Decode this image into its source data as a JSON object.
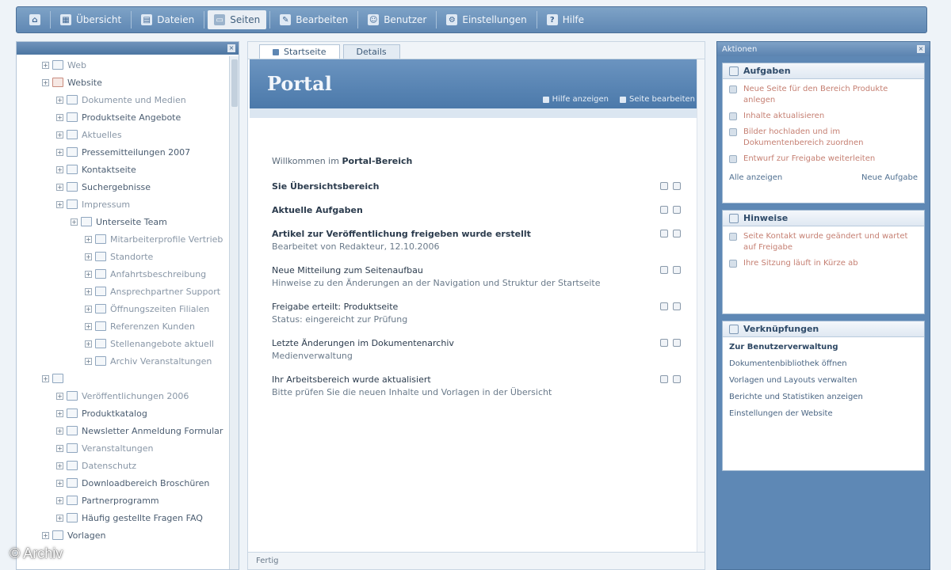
{
  "toolbar": {
    "items": [
      {
        "icon": "home-icon",
        "label": ""
      },
      {
        "icon": "dashboard-icon",
        "label": "Übersicht"
      },
      {
        "icon": "folder-icon",
        "label": "Dateien"
      },
      {
        "icon": "page-icon",
        "label": "Seiten"
      },
      {
        "icon": "edit-icon",
        "label": "Bearbeiten"
      },
      {
        "icon": "user-icon",
        "label": "Benutzer"
      },
      {
        "icon": "settings-icon",
        "label": "Einstellungen"
      },
      {
        "icon": "help-icon",
        "label": "Hilfe"
      }
    ],
    "active_index": 3
  },
  "left": {
    "tree": [
      {
        "depth": 1,
        "label": "Web",
        "style": "faint"
      },
      {
        "depth": 1,
        "label": "Website",
        "style": "normal",
        "icon": "red"
      },
      {
        "depth": 2,
        "label": "Dokumente und Medien",
        "style": "faint"
      },
      {
        "depth": 2,
        "label": "Produktseite Angebote",
        "style": "normal"
      },
      {
        "depth": 2,
        "label": "Aktuelles",
        "style": "faint"
      },
      {
        "depth": 2,
        "label": "Pressemitteilungen 2007",
        "style": "normal"
      },
      {
        "depth": 2,
        "label": "Kontaktseite",
        "style": "normal"
      },
      {
        "depth": 2,
        "label": "Suchergebnisse",
        "style": "normal"
      },
      {
        "depth": 2,
        "label": "Impressum",
        "style": "faint"
      },
      {
        "depth": 3,
        "label": "Unterseite Team",
        "style": "normal"
      },
      {
        "depth": 4,
        "label": "Mitarbeiterprofile Vertrieb",
        "style": "faint"
      },
      {
        "depth": 4,
        "label": "Standorte",
        "style": "faint"
      },
      {
        "depth": 4,
        "label": "Anfahrtsbeschreibung",
        "style": "faint"
      },
      {
        "depth": 4,
        "label": "Ansprechpartner Support",
        "style": "faint"
      },
      {
        "depth": 4,
        "label": "Öffnungszeiten Filialen",
        "style": "faint"
      },
      {
        "depth": 4,
        "label": "Referenzen Kunden",
        "style": "faint"
      },
      {
        "depth": 4,
        "label": "Stellenangebote aktuell",
        "style": "faint"
      },
      {
        "depth": 4,
        "label": "Archiv Veranstaltungen",
        "style": "faint"
      },
      {
        "depth": 1,
        "label": "",
        "style": "faint"
      },
      {
        "depth": 2,
        "label": "Veröffentlichungen 2006",
        "style": "faint"
      },
      {
        "depth": 2,
        "label": "Produktkatalog",
        "style": "normal"
      },
      {
        "depth": 2,
        "label": "Newsletter Anmeldung Formular",
        "style": "normal"
      },
      {
        "depth": 2,
        "label": "Veranstaltungen",
        "style": "faint"
      },
      {
        "depth": 2,
        "label": "Datenschutz",
        "style": "faint"
      },
      {
        "depth": 2,
        "label": "Downloadbereich Broschüren",
        "style": "normal"
      },
      {
        "depth": 2,
        "label": "Partnerprogramm",
        "style": "normal"
      },
      {
        "depth": 2,
        "label": "Häufig gestellte Fragen FAQ",
        "style": "normal"
      },
      {
        "depth": 1,
        "label": "Vorlagen",
        "style": "normal"
      }
    ]
  },
  "center": {
    "tabs": [
      "Startseite",
      "Details"
    ],
    "title": "Portal",
    "banner_links": [
      "Hilfe anzeigen",
      "Seite bearbeiten"
    ],
    "intro_prefix": "Willkommen im",
    "intro_bold": "Portal-Bereich",
    "entries": [
      {
        "heading": "Sie Übersichtsbereich",
        "sub": "",
        "bold": true
      },
      {
        "heading": "Aktuelle Aufgaben",
        "sub": "",
        "bold": true
      },
      {
        "heading": "Artikel zur Veröffentlichung freigeben wurde erstellt",
        "sub": "Bearbeitet von Redakteur, 12.10.2006",
        "bold": true
      },
      {
        "heading": "Neue Mitteilung zum Seitenaufbau",
        "sub": "Hinweise zu den Änderungen an der Navigation und Struktur der Startseite",
        "bold": false
      },
      {
        "heading": "Freigabe erteilt: Produktseite",
        "sub": "Status: eingereicht zur Prüfung",
        "bold": false
      },
      {
        "heading": "Letzte Änderungen im Dokumentenarchiv",
        "sub": "Medienverwaltung",
        "bold": false
      },
      {
        "heading": "Ihr Arbeitsbereich wurde aktualisiert",
        "sub": "Bitte prüfen Sie die neuen Inhalte und Vorlagen in der Übersicht",
        "bold": false
      }
    ],
    "status": "Fertig"
  },
  "right": {
    "header": "Aktionen",
    "panel1": {
      "title": "Aufgaben",
      "items": [
        {
          "text": "Neue Seite für den Bereich Produkte anlegen",
          "tone": "red"
        },
        {
          "text": "Inhalte aktualisieren",
          "tone": "red"
        },
        {
          "text": "Bilder hochladen und im Dokumentenbereich zuordnen",
          "tone": "red"
        },
        {
          "text": "Entwurf zur Freigabe weiterleiten",
          "tone": "red"
        }
      ],
      "footer_left": "Alle anzeigen",
      "footer_right": "Neue Aufgabe"
    },
    "panel2": {
      "title": "Hinweise",
      "items": [
        {
          "text": "Seite Kontakt wurde geändert und wartet auf Freigabe",
          "tone": "red"
        },
        {
          "text": "Ihre Sitzung läuft in Kürze ab",
          "tone": "red"
        }
      ]
    },
    "panel3": {
      "title": "Verknüpfungen",
      "items": [
        {
          "text": "Zur Benutzerverwaltung",
          "strong": true
        },
        {
          "text": "Dokumentenbibliothek öffnen",
          "strong": false
        },
        {
          "text": "Vorlagen und Layouts verwalten",
          "strong": false
        },
        {
          "text": "Berichte und Statistiken anzeigen",
          "strong": false
        },
        {
          "text": "Einstellungen der Website",
          "strong": false
        }
      ]
    }
  },
  "watermark": "© Archiv",
  "colors": {
    "accent": "#5e88b5",
    "banner": "#4b79aa",
    "link_red": "#c57f72"
  }
}
